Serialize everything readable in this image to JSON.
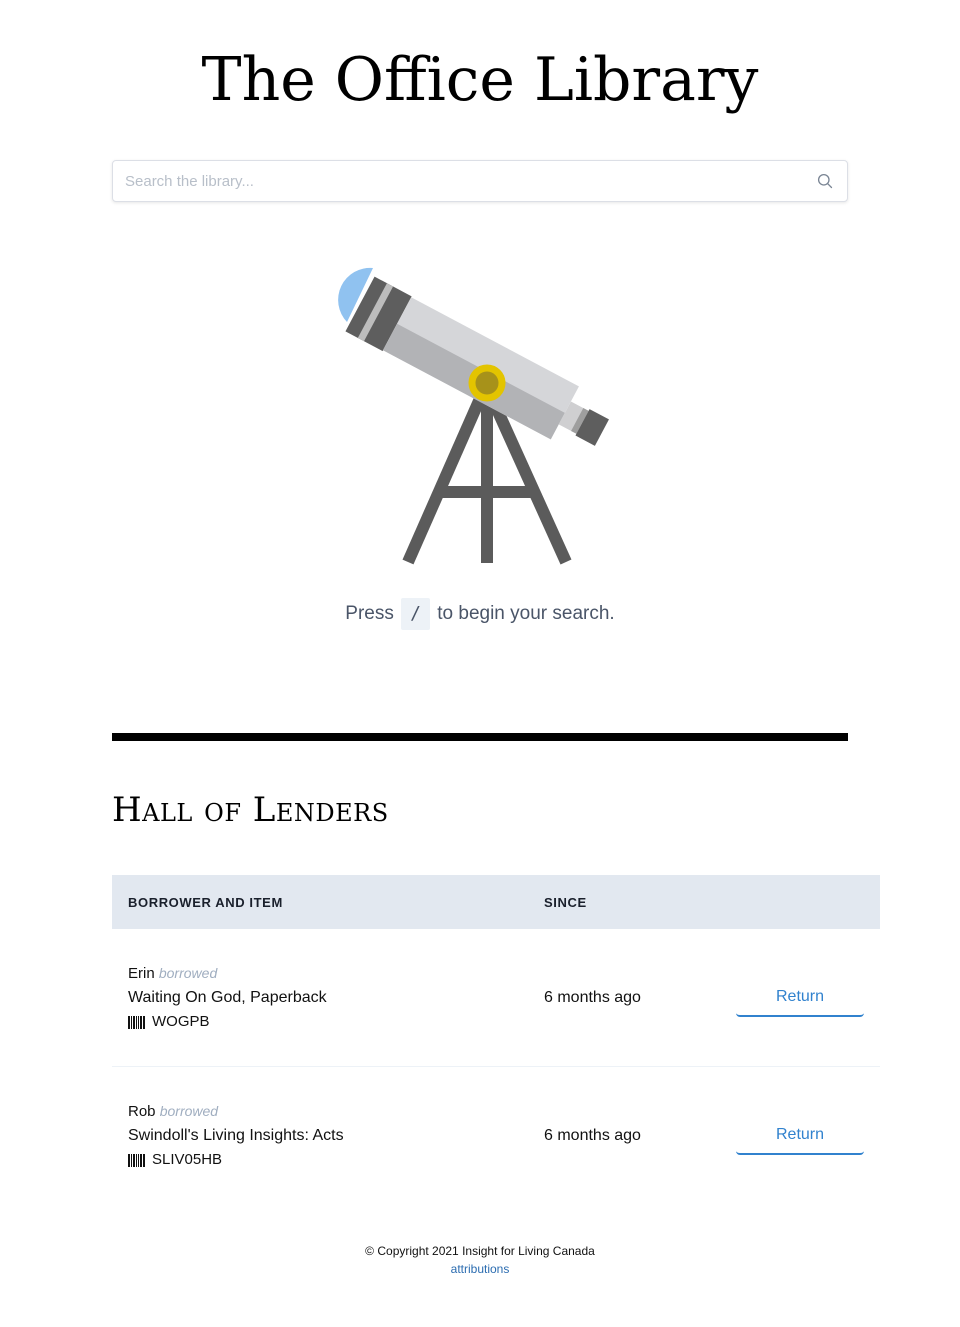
{
  "header": {
    "title": "The Office Library"
  },
  "search": {
    "placeholder": "Search the library..."
  },
  "hint": {
    "before": "Press",
    "key": "/",
    "after": "to begin your search."
  },
  "lenders": {
    "title": "Hall of Lenders",
    "columns": {
      "item": "BORROWER AND ITEM",
      "since": "SINCE"
    },
    "rows": [
      {
        "borrower": "Erin",
        "verb": "borrowed",
        "item": "Waiting On God, Paperback",
        "sku": "WOGPB",
        "since": "6 months ago",
        "action": "Return"
      },
      {
        "borrower": "Rob",
        "verb": "borrowed",
        "item": "Swindoll's Living Insights: Acts",
        "sku": "SLIV05HB",
        "since": "6 months ago",
        "action": "Return"
      }
    ]
  },
  "footer": {
    "copyright": "© Copyright 2021 Insight for Living Canada",
    "link": "attributions"
  },
  "colors": {
    "accent": "#3182ce",
    "table_header_bg": "#e2e8f0",
    "telescope_lens": "#90c2f0",
    "telescope_mount": "#e3c400"
  },
  "icons": {
    "search": "search-icon",
    "barcode": "barcode-icon",
    "illustration": "telescope-icon"
  }
}
